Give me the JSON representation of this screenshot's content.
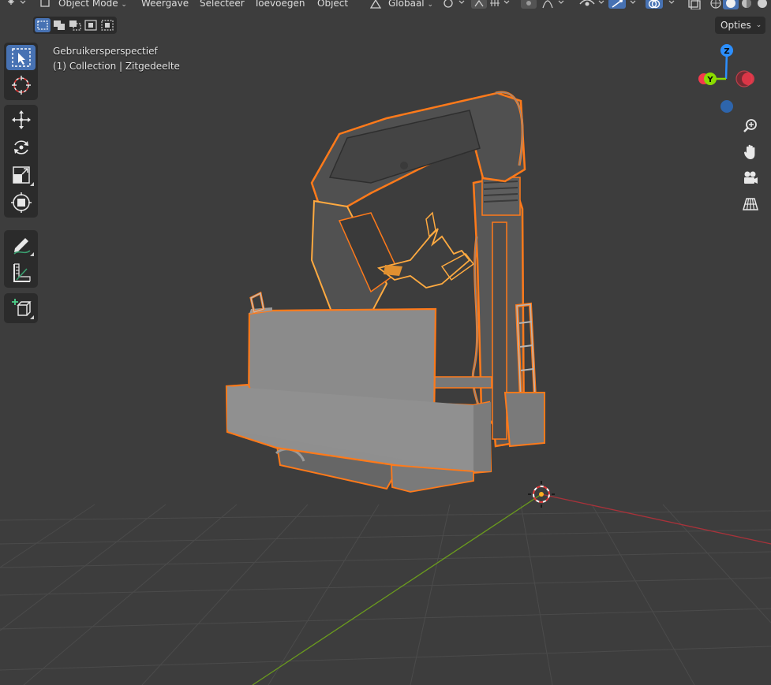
{
  "header": {
    "mode_label": "Object Mode",
    "menu": [
      "Weergave",
      "Selecteer",
      "Toevoegen",
      "Object"
    ],
    "transform_orientation": "Globaal"
  },
  "selection_modes": [
    "set",
    "extend",
    "subtract",
    "invert",
    "intersect"
  ],
  "options_label": "Opties",
  "overlay": {
    "view_name": "Gebruikersperspectief",
    "collection_line": "(1) Collection | Zitgedeelte"
  },
  "gizmo": {
    "axes": {
      "z": "Z",
      "y": "Y"
    },
    "colors": {
      "x": "#f53a4c",
      "y": "#8bdc00",
      "z": "#2c8fff"
    }
  },
  "toolbar_tools": [
    "select-box-icon",
    "cursor-icon",
    "move-icon",
    "rotate-icon",
    "scale-icon",
    "transform-icon",
    "annotate-icon",
    "measure-icon",
    "add-cube-icon"
  ],
  "nav_buttons": [
    "zoom-icon",
    "pan-hand-icon",
    "camera-icon",
    "grid-perspective-icon"
  ],
  "colors": {
    "background": "#3d3d3d",
    "accent": "#4772b3",
    "selection_outline": "#ff7a1a",
    "active_outline": "#ffaa40",
    "x_axis_line": "#a8323a",
    "y_axis_line": "#6a9a1e"
  }
}
